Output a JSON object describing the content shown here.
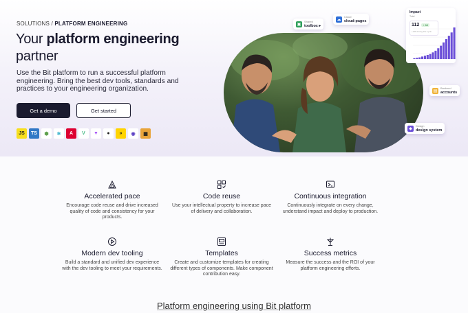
{
  "hero": {
    "breadcrumb_parent": "SOLUTIONS",
    "breadcrumb_sep": "/",
    "breadcrumb_current": "PLATFORM ENGINEERING",
    "title_plain": "Your",
    "title_bold": "platform engineering",
    "title_end": "partner",
    "subtitle": "Use the Bit platform to run a successful platform engineering. Bring the best dev tools, standards and practices to your engineering organization.",
    "cta_primary": "Get a demo",
    "cta_secondary": "Get started"
  },
  "tech_icons": [
    {
      "name": "javascript-icon",
      "glyph": "JS",
      "bg": "#f7df1e",
      "fg": "#1b1b1b"
    },
    {
      "name": "typescript-icon",
      "glyph": "TS",
      "bg": "#3178c6",
      "fg": "#ffffff"
    },
    {
      "name": "nodejs-icon",
      "glyph": "⬢",
      "bg": "#ffffff",
      "fg": "#5fa04e"
    },
    {
      "name": "react-icon",
      "glyph": "⚛",
      "bg": "#ffffff",
      "fg": "#1ea7c5"
    },
    {
      "name": "angular-icon",
      "glyph": "A",
      "bg": "#dd0031",
      "fg": "#ffffff"
    },
    {
      "name": "vue-icon",
      "glyph": "V",
      "bg": "#ffffff",
      "fg": "#42b883"
    },
    {
      "name": "vite-icon",
      "glyph": "▼",
      "bg": "#ffffff",
      "fg": "#a855f7"
    },
    {
      "name": "github-icon",
      "glyph": "●",
      "bg": "#ffffff",
      "fg": "#1b1b1b"
    },
    {
      "name": "netlify-icon",
      "glyph": "»",
      "bg": "#ffd400",
      "fg": "#1b1b1b"
    },
    {
      "name": "graphql-icon",
      "glyph": "◉",
      "bg": "#ffffff",
      "fg": "#5b3fc4"
    },
    {
      "name": "jamstack-icon",
      "glyph": "▦",
      "bg": "#e8a43a",
      "fg": "#1b1b1b"
    }
  ],
  "float_cards": {
    "toolbox": {
      "small": "Shared",
      "big": "toolbox ▸",
      "color": "#2e9f5b"
    },
    "cloud_pages": {
      "small": "Cloud",
      "big": "cloud-pages",
      "color": "#2f6fd8"
    },
    "accounts": {
      "small": "Backend",
      "big": "accounts",
      "color": "#f0b43a"
    },
    "design_system": {
      "small": "Design",
      "big": "design system",
      "color": "#6b4fd8"
    }
  },
  "impact": {
    "title": "Impact",
    "sub": "Total",
    "value": "112",
    "delta": "+ 68",
    "note": "+248 during this cycle"
  },
  "chart_data": {
    "type": "bar",
    "values": [
      1,
      1.5,
      2,
      3,
      4,
      5,
      6,
      8,
      10,
      13,
      16,
      20,
      24,
      28,
      32,
      38
    ],
    "color": "#6b4fd8"
  },
  "features": [
    {
      "icon": "triangle-pace-icon",
      "name": "Accelerated pace",
      "desc": "Encourage code reuse and drive increased quality of code and consistency for your products."
    },
    {
      "icon": "code-reuse-icon",
      "name": "Code reuse",
      "desc": "Use your intellectual property to increase pace of delivery and collaboration."
    },
    {
      "icon": "integration-icon",
      "name": "Continuous integration",
      "desc": "Continuously integrate on every change, understand impact and deploy to production."
    },
    {
      "icon": "play-tooling-icon",
      "name": "Modern dev tooling",
      "desc": "Build a standard and unified dev experience with the dev tooling to meet your requirements."
    },
    {
      "icon": "templates-icon",
      "name": "Templates",
      "desc": "Create and customize templates for creating different types of components. Make component contribution easy."
    },
    {
      "icon": "metrics-icon",
      "name": "Success metrics",
      "desc": "Measure the success and the ROI of your platform engineering efforts."
    }
  ],
  "footer": {
    "link": "Platform engineering using Bit platform"
  }
}
